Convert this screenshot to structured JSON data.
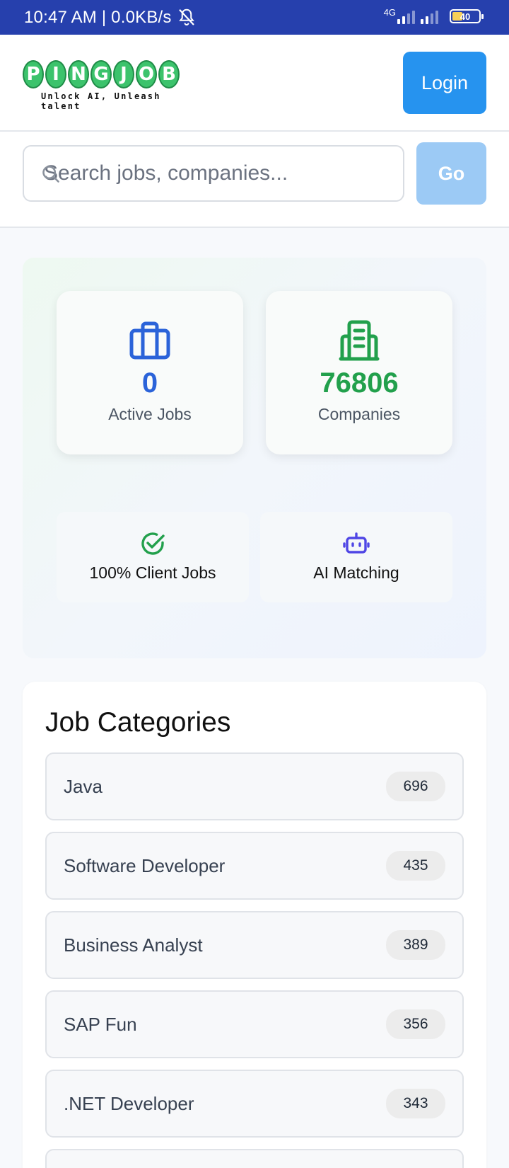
{
  "status_bar": {
    "time": "10:47 AM | 0.0KB/s",
    "network": "4G",
    "battery": "40"
  },
  "header": {
    "logo_letters": [
      "P",
      "I",
      "N",
      "G",
      "J",
      "O",
      "B"
    ],
    "tagline": "Unlock AI, Unleash talent",
    "login_label": "Login"
  },
  "search": {
    "placeholder": "Search jobs, companies...",
    "go_label": "Go"
  },
  "stats": {
    "active_jobs": {
      "value": "0",
      "label": "Active Jobs"
    },
    "companies": {
      "value": "76806",
      "label": "Companies"
    }
  },
  "features": {
    "client_jobs": "100% Client Jobs",
    "ai_matching": "AI Matching"
  },
  "categories": {
    "title": "Job Categories",
    "items": [
      {
        "name": "Java",
        "count": "696"
      },
      {
        "name": "Software Developer",
        "count": "435"
      },
      {
        "name": "Business Analyst",
        "count": "389"
      },
      {
        "name": "SAP Fun",
        "count": "356"
      },
      {
        "name": ".NET Developer",
        "count": "343"
      }
    ]
  },
  "colors": {
    "status_bar": "#2640ad",
    "primary": "#2693ef",
    "primary_disabled": "#9ccaf5",
    "jobs_accent": "#2b63d9",
    "companies_accent": "#22a04c",
    "ai_accent": "#4f46e5"
  }
}
